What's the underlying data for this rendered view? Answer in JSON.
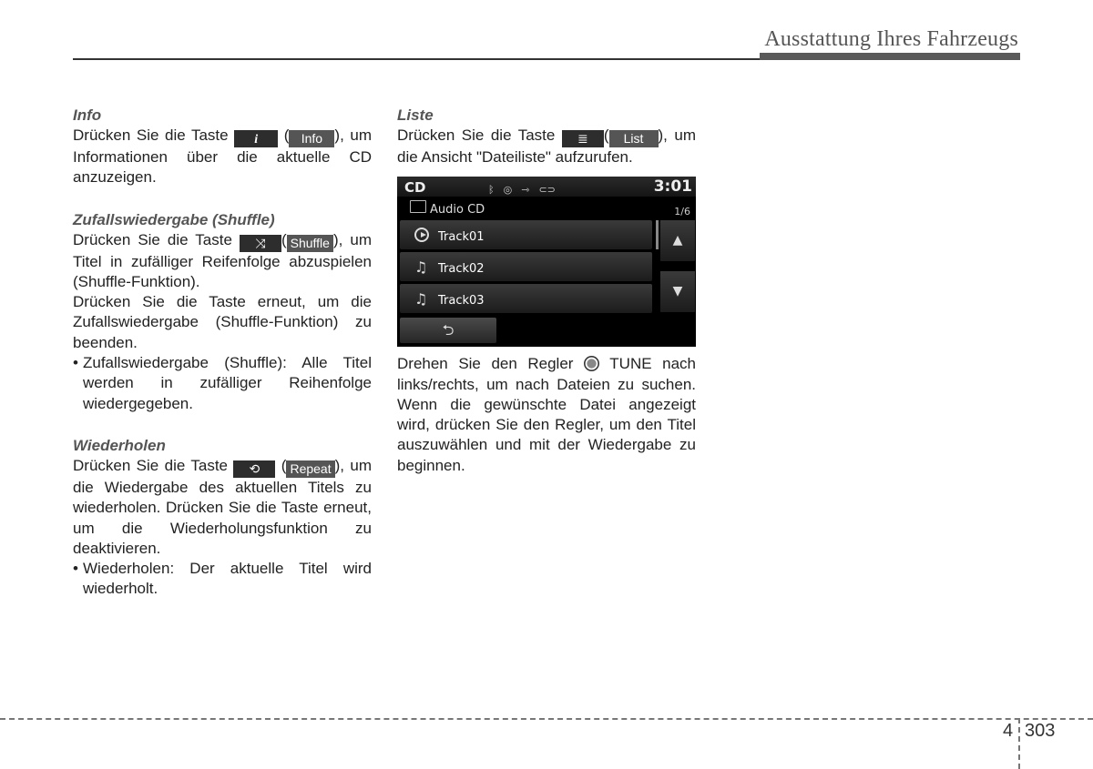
{
  "header": {
    "title": "Ausstattung Ihres Fahrzeugs"
  },
  "left": {
    "info": {
      "heading": "Info",
      "pre": "Drücken Sie die Taste",
      "key_icon": "i",
      "label": "Info",
      "post": "um Informationen über die aktuelle CD anzuzeigen."
    },
    "shuffle": {
      "heading": "Zufallswiedergabe (Shuffle)",
      "pre": "Drücken Sie die Taste",
      "key_icon": "⤨",
      "label": "Shuffle",
      "post": "um Titel in zufälliger Reifenfolge abzuspielen (Shuffle-Funktion).",
      "para2": "Drücken Sie die Taste erneut, um die Zufallswiedergabe (Shuffle-Funktion) zu beenden.",
      "bullet": "Zufallswiedergabe (Shuffle): Alle Titel werden in zufälliger Reihenfolge wiedergegeben."
    },
    "repeat": {
      "heading": "Wiederholen",
      "pre": "Drücken Sie die Taste",
      "key_icon": "⟲",
      "label": "Repeat",
      "post": "um die Wiedergabe des aktuellen Titels zu wiederholen. Drücken Sie die Taste erneut, um die Wiederholungsfunktion zu deaktivieren.",
      "bullet": "Wiederholen: Der aktuelle Titel wird wiederholt."
    }
  },
  "right": {
    "list": {
      "heading": "Liste",
      "pre": "Drücken Sie die Taste",
      "key_icon": "≣",
      "label": "List",
      "post": "um die Ansicht \"Dateiliste\" aufzurufen."
    },
    "screen": {
      "source": "CD",
      "time": "3:01",
      "status_icons": [
        "bluetooth-icon",
        "disc-icon",
        "usb-icon",
        "aux-icon"
      ],
      "folder": "Audio CD",
      "count": "1/6",
      "tracks": [
        {
          "name": "Track01",
          "icon": "play-icon"
        },
        {
          "name": "Track02",
          "icon": "music-note-icon"
        },
        {
          "name": "Track03",
          "icon": "music-note-icon"
        }
      ],
      "up": "▲",
      "down": "▼",
      "back": "⮌"
    },
    "tune": {
      "pre": "Drehen Sie den Regler",
      "post": "TUNE nach links/rechts, um nach Dateien zu suchen. Wenn die gewünschte Datei angezeigt wird, drücken Sie den Regler, um den Titel auszuwählen und mit der Wiedergabe zu beginnen."
    }
  },
  "footer": {
    "chapter": "4",
    "page": "303"
  }
}
